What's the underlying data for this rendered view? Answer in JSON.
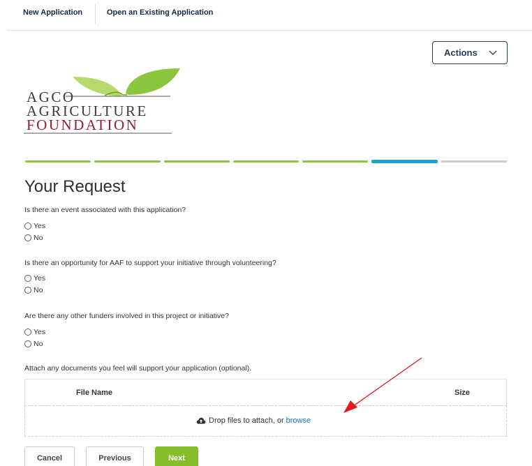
{
  "topnav": {
    "new_application": "New Application",
    "open_existing": "Open an Existing Application"
  },
  "actions": {
    "label": "Actions"
  },
  "logo": {
    "line1": "AGCO",
    "line2": "AGRICULTURE",
    "line3": "FOUNDATION"
  },
  "progress": {
    "steps": 7,
    "current": 6,
    "colors": {
      "done": "#8cc63f",
      "active": "#1aa3d4",
      "todo": "#cccccc"
    }
  },
  "page_title": "Your Request",
  "questions": [
    {
      "text": "Is there an event associated with this application?",
      "options": [
        "Yes",
        "No"
      ]
    },
    {
      "text": "Is there an opportunity for AAF to support your initiative through volunteering?",
      "options": [
        "Yes",
        "No"
      ]
    },
    {
      "text": "Are there any other funders involved in this project or initiative?",
      "options": [
        "Yes",
        "No"
      ]
    }
  ],
  "attachments": {
    "prompt": "Attach any documents you feel will support your application (optional).",
    "col_file_name": "File Name",
    "col_size": "Size",
    "drop_text": "Drop files to attach, or",
    "browse": "browse"
  },
  "buttons": {
    "cancel": "Cancel",
    "previous": "Previous",
    "next": "Next"
  }
}
